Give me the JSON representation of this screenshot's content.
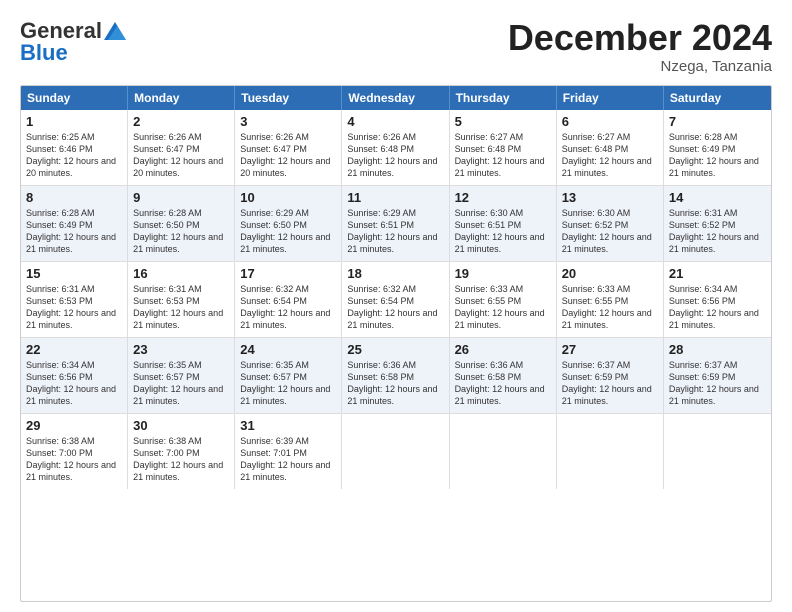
{
  "header": {
    "logo_general": "General",
    "logo_blue": "Blue",
    "month_title": "December 2024",
    "location": "Nzega, Tanzania"
  },
  "weekdays": [
    "Sunday",
    "Monday",
    "Tuesday",
    "Wednesday",
    "Thursday",
    "Friday",
    "Saturday"
  ],
  "rows": [
    [
      {
        "day": "1",
        "sunrise": "Sunrise: 6:25 AM",
        "sunset": "Sunset: 6:46 PM",
        "daylight": "Daylight: 12 hours and 20 minutes."
      },
      {
        "day": "2",
        "sunrise": "Sunrise: 6:26 AM",
        "sunset": "Sunset: 6:47 PM",
        "daylight": "Daylight: 12 hours and 20 minutes."
      },
      {
        "day": "3",
        "sunrise": "Sunrise: 6:26 AM",
        "sunset": "Sunset: 6:47 PM",
        "daylight": "Daylight: 12 hours and 20 minutes."
      },
      {
        "day": "4",
        "sunrise": "Sunrise: 6:26 AM",
        "sunset": "Sunset: 6:48 PM",
        "daylight": "Daylight: 12 hours and 21 minutes."
      },
      {
        "day": "5",
        "sunrise": "Sunrise: 6:27 AM",
        "sunset": "Sunset: 6:48 PM",
        "daylight": "Daylight: 12 hours and 21 minutes."
      },
      {
        "day": "6",
        "sunrise": "Sunrise: 6:27 AM",
        "sunset": "Sunset: 6:48 PM",
        "daylight": "Daylight: 12 hours and 21 minutes."
      },
      {
        "day": "7",
        "sunrise": "Sunrise: 6:28 AM",
        "sunset": "Sunset: 6:49 PM",
        "daylight": "Daylight: 12 hours and 21 minutes."
      }
    ],
    [
      {
        "day": "8",
        "sunrise": "Sunrise: 6:28 AM",
        "sunset": "Sunset: 6:49 PM",
        "daylight": "Daylight: 12 hours and 21 minutes."
      },
      {
        "day": "9",
        "sunrise": "Sunrise: 6:28 AM",
        "sunset": "Sunset: 6:50 PM",
        "daylight": "Daylight: 12 hours and 21 minutes."
      },
      {
        "day": "10",
        "sunrise": "Sunrise: 6:29 AM",
        "sunset": "Sunset: 6:50 PM",
        "daylight": "Daylight: 12 hours and 21 minutes."
      },
      {
        "day": "11",
        "sunrise": "Sunrise: 6:29 AM",
        "sunset": "Sunset: 6:51 PM",
        "daylight": "Daylight: 12 hours and 21 minutes."
      },
      {
        "day": "12",
        "sunrise": "Sunrise: 6:30 AM",
        "sunset": "Sunset: 6:51 PM",
        "daylight": "Daylight: 12 hours and 21 minutes."
      },
      {
        "day": "13",
        "sunrise": "Sunrise: 6:30 AM",
        "sunset": "Sunset: 6:52 PM",
        "daylight": "Daylight: 12 hours and 21 minutes."
      },
      {
        "day": "14",
        "sunrise": "Sunrise: 6:31 AM",
        "sunset": "Sunset: 6:52 PM",
        "daylight": "Daylight: 12 hours and 21 minutes."
      }
    ],
    [
      {
        "day": "15",
        "sunrise": "Sunrise: 6:31 AM",
        "sunset": "Sunset: 6:53 PM",
        "daylight": "Daylight: 12 hours and 21 minutes."
      },
      {
        "day": "16",
        "sunrise": "Sunrise: 6:31 AM",
        "sunset": "Sunset: 6:53 PM",
        "daylight": "Daylight: 12 hours and 21 minutes."
      },
      {
        "day": "17",
        "sunrise": "Sunrise: 6:32 AM",
        "sunset": "Sunset: 6:54 PM",
        "daylight": "Daylight: 12 hours and 21 minutes."
      },
      {
        "day": "18",
        "sunrise": "Sunrise: 6:32 AM",
        "sunset": "Sunset: 6:54 PM",
        "daylight": "Daylight: 12 hours and 21 minutes."
      },
      {
        "day": "19",
        "sunrise": "Sunrise: 6:33 AM",
        "sunset": "Sunset: 6:55 PM",
        "daylight": "Daylight: 12 hours and 21 minutes."
      },
      {
        "day": "20",
        "sunrise": "Sunrise: 6:33 AM",
        "sunset": "Sunset: 6:55 PM",
        "daylight": "Daylight: 12 hours and 21 minutes."
      },
      {
        "day": "21",
        "sunrise": "Sunrise: 6:34 AM",
        "sunset": "Sunset: 6:56 PM",
        "daylight": "Daylight: 12 hours and 21 minutes."
      }
    ],
    [
      {
        "day": "22",
        "sunrise": "Sunrise: 6:34 AM",
        "sunset": "Sunset: 6:56 PM",
        "daylight": "Daylight: 12 hours and 21 minutes."
      },
      {
        "day": "23",
        "sunrise": "Sunrise: 6:35 AM",
        "sunset": "Sunset: 6:57 PM",
        "daylight": "Daylight: 12 hours and 21 minutes."
      },
      {
        "day": "24",
        "sunrise": "Sunrise: 6:35 AM",
        "sunset": "Sunset: 6:57 PM",
        "daylight": "Daylight: 12 hours and 21 minutes."
      },
      {
        "day": "25",
        "sunrise": "Sunrise: 6:36 AM",
        "sunset": "Sunset: 6:58 PM",
        "daylight": "Daylight: 12 hours and 21 minutes."
      },
      {
        "day": "26",
        "sunrise": "Sunrise: 6:36 AM",
        "sunset": "Sunset: 6:58 PM",
        "daylight": "Daylight: 12 hours and 21 minutes."
      },
      {
        "day": "27",
        "sunrise": "Sunrise: 6:37 AM",
        "sunset": "Sunset: 6:59 PM",
        "daylight": "Daylight: 12 hours and 21 minutes."
      },
      {
        "day": "28",
        "sunrise": "Sunrise: 6:37 AM",
        "sunset": "Sunset: 6:59 PM",
        "daylight": "Daylight: 12 hours and 21 minutes."
      }
    ],
    [
      {
        "day": "29",
        "sunrise": "Sunrise: 6:38 AM",
        "sunset": "Sunset: 7:00 PM",
        "daylight": "Daylight: 12 hours and 21 minutes."
      },
      {
        "day": "30",
        "sunrise": "Sunrise: 6:38 AM",
        "sunset": "Sunset: 7:00 PM",
        "daylight": "Daylight: 12 hours and 21 minutes."
      },
      {
        "day": "31",
        "sunrise": "Sunrise: 6:39 AM",
        "sunset": "Sunset: 7:01 PM",
        "daylight": "Daylight: 12 hours and 21 minutes."
      },
      null,
      null,
      null,
      null
    ]
  ]
}
